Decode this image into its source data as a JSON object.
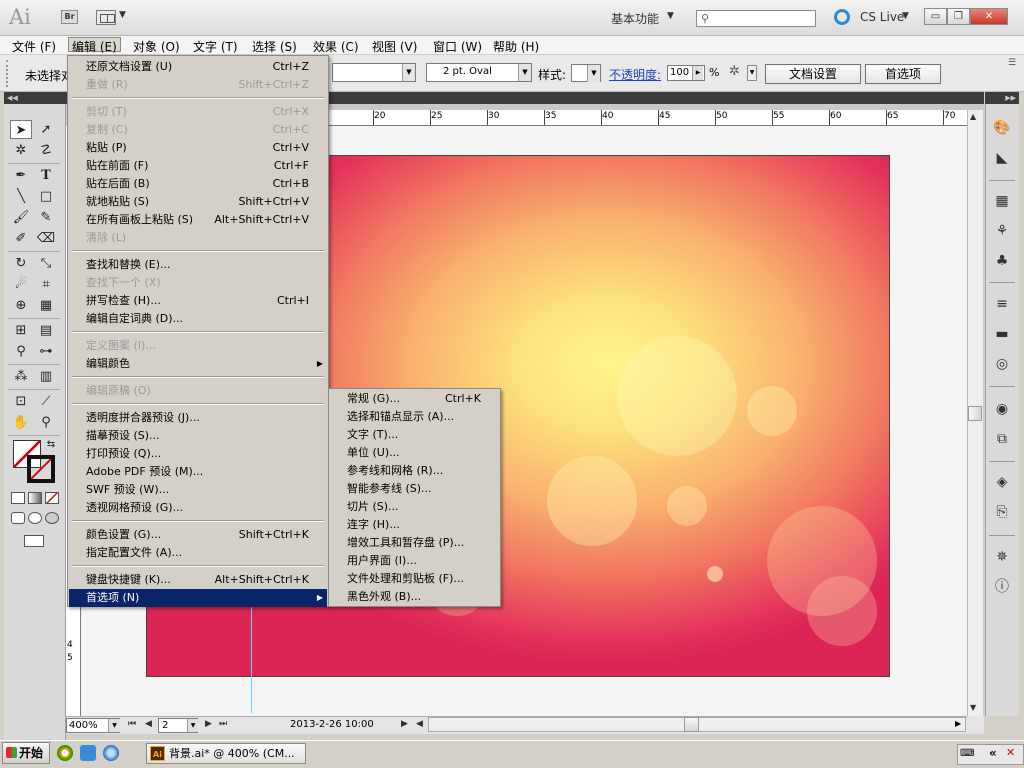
{
  "titlebar": {
    "app_logo": "Ai",
    "bridge_label": "Br",
    "workspace": "基本功能",
    "cs_live": "CS Live",
    "search_icon": "search-icon",
    "minimize": "▭",
    "restore": "❐",
    "close": "✕"
  },
  "menubar": [
    {
      "label": "文件 (F)"
    },
    {
      "label": "编辑 (E)"
    },
    {
      "label": "对象 (O)"
    },
    {
      "label": "文字 (T)"
    },
    {
      "label": "选择 (S)"
    },
    {
      "label": "效果 (C)"
    },
    {
      "label": "视图 (V)"
    },
    {
      "label": "窗口 (W)"
    },
    {
      "label": "帮助 (H)"
    }
  ],
  "control": {
    "selection_status": "未选择对",
    "brush": "2 pt. Oval",
    "style_label": "样式:",
    "opacity_label": "不透明度:",
    "opacity_value": "100",
    "opacity_unit": "%",
    "doc_setup": "文档设置",
    "prefs": "首选项"
  },
  "ruler": {
    "top": [
      "20",
      "25",
      "30",
      "35",
      "40",
      "45",
      "50",
      "55",
      "60",
      "65",
      "70"
    ],
    "left": [
      "4",
      "5"
    ]
  },
  "edit_menu": {
    "items": [
      {
        "label": "还原文档设置 (U)",
        "shortcut": "Ctrl+Z",
        "enabled": true
      },
      {
        "label": "重做 (R)",
        "shortcut": "Shift+Ctrl+Z",
        "enabled": false
      },
      {
        "label": "剪切 (T)",
        "shortcut": "Ctrl+X",
        "enabled": false
      },
      {
        "label": "复制 (C)",
        "shortcut": "Ctrl+C",
        "enabled": false
      },
      {
        "label": "粘贴 (P)",
        "shortcut": "Ctrl+V",
        "enabled": true
      },
      {
        "label": "贴在前面 (F)",
        "shortcut": "Ctrl+F",
        "enabled": true
      },
      {
        "label": "贴在后面 (B)",
        "shortcut": "Ctrl+B",
        "enabled": true
      },
      {
        "label": "就地粘贴 (S)",
        "shortcut": "Shift+Ctrl+V",
        "enabled": true
      },
      {
        "label": "在所有画板上粘贴 (S)",
        "shortcut": "Alt+Shift+Ctrl+V",
        "enabled": true
      },
      {
        "label": "清除 (L)",
        "shortcut": "",
        "enabled": false
      },
      {
        "label": "查找和替换 (E)...",
        "shortcut": "",
        "enabled": true
      },
      {
        "label": "查找下一个 (X)",
        "shortcut": "",
        "enabled": false
      },
      {
        "label": "拼写检查 (H)...",
        "shortcut": "Ctrl+I",
        "enabled": true
      },
      {
        "label": "编辑自定词典 (D)...",
        "shortcut": "",
        "enabled": true
      },
      {
        "label": "定义图案 (I)...",
        "shortcut": "",
        "enabled": false
      },
      {
        "label": "编辑颜色",
        "shortcut": "",
        "enabled": true
      },
      {
        "label": "编辑原稿 (O)",
        "shortcut": "",
        "enabled": false
      },
      {
        "label": "透明度拼合器预设 (J)...",
        "shortcut": "",
        "enabled": true
      },
      {
        "label": "描摹预设 (S)...",
        "shortcut": "",
        "enabled": true
      },
      {
        "label": "打印预设 (Q)...",
        "shortcut": "",
        "enabled": true
      },
      {
        "label": "Adobe PDF 预设 (M)...",
        "shortcut": "",
        "enabled": true
      },
      {
        "label": "SWF 预设 (W)...",
        "shortcut": "",
        "enabled": true
      },
      {
        "label": "透视网格预设 (G)...",
        "shortcut": "",
        "enabled": true
      },
      {
        "label": "颜色设置 (G)...",
        "shortcut": "Shift+Ctrl+K",
        "enabled": true
      },
      {
        "label": "指定配置文件 (A)...",
        "shortcut": "",
        "enabled": true
      },
      {
        "label": "键盘快捷键 (K)...",
        "shortcut": "Alt+Shift+Ctrl+K",
        "enabled": true
      },
      {
        "label": "首选项 (N)",
        "shortcut": "",
        "enabled": true
      }
    ]
  },
  "prefs_menu": {
    "items": [
      {
        "label": "常规 (G)...",
        "shortcut": "Ctrl+K"
      },
      {
        "label": "选择和锚点显示 (A)...",
        "shortcut": ""
      },
      {
        "label": "文字 (T)...",
        "shortcut": ""
      },
      {
        "label": "单位 (U)...",
        "shortcut": ""
      },
      {
        "label": "参考线和网格 (R)...",
        "shortcut": ""
      },
      {
        "label": "智能参考线 (S)...",
        "shortcut": ""
      },
      {
        "label": "切片 (S)...",
        "shortcut": ""
      },
      {
        "label": "连字 (H)...",
        "shortcut": ""
      },
      {
        "label": "增效工具和暂存盘 (P)...",
        "shortcut": ""
      },
      {
        "label": "用户界面 (I)...",
        "shortcut": ""
      },
      {
        "label": "文件处理和剪贴板 (F)...",
        "shortcut": ""
      },
      {
        "label": "黑色外观 (B)...",
        "shortcut": ""
      }
    ]
  },
  "status": {
    "zoom": "400%",
    "page": "2",
    "datetime": "2013-2-26  10:00"
  },
  "taskbar": {
    "start": "开始",
    "task_label": "背景.ai* @ 400% (CM...",
    "task_icon": "Ai"
  },
  "colors": {
    "menu_highlight": "#0a246a",
    "guide": "#5ad6ff",
    "artboard_center": "#fff58a",
    "artboard_edge": "#dc2555"
  }
}
